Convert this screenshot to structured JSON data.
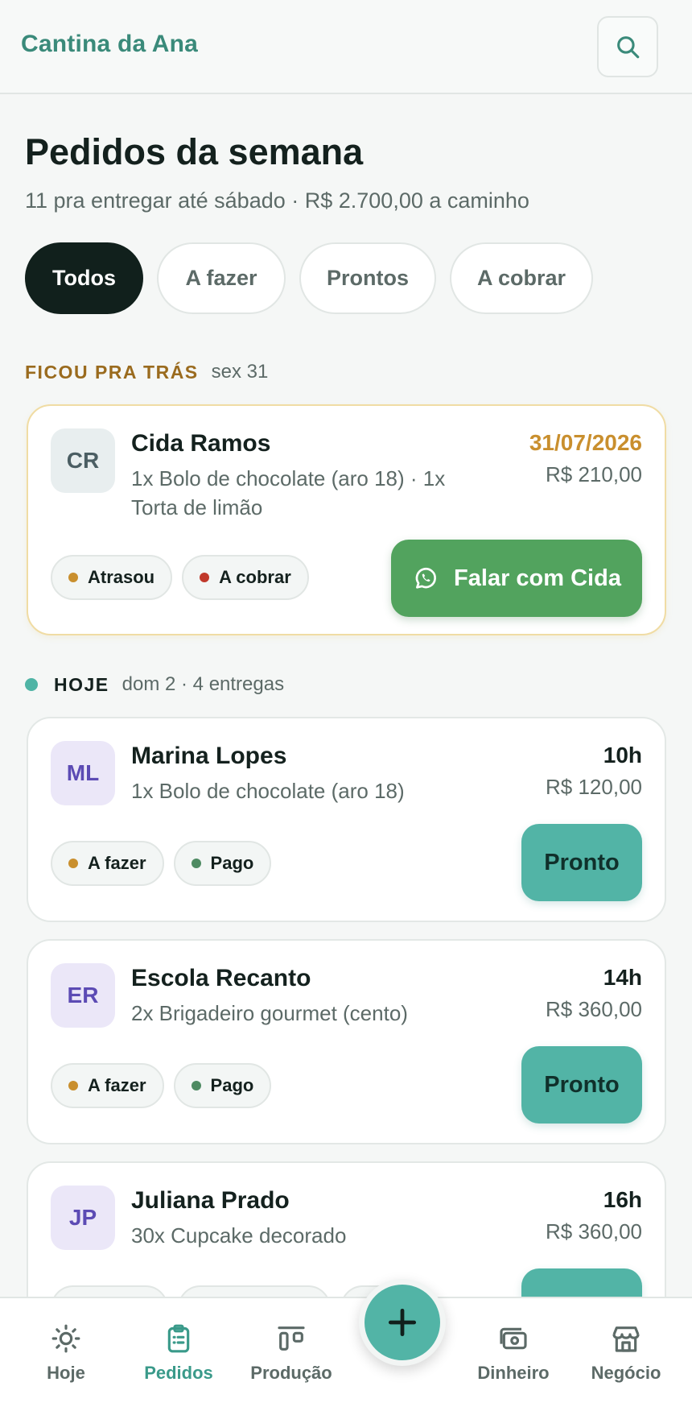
{
  "app": {
    "brand": "Cantina da Ana"
  },
  "header": {
    "title": "Pedidos da semana",
    "subtitle": "11 pra entregar até sábado · R$ 2.700,00 a caminho"
  },
  "filters": [
    "Todos",
    "A fazer",
    "Prontos",
    "A cobrar"
  ],
  "sections": {
    "late": {
      "label": "FICOU PRA TRÁS",
      "meta": "sex 31"
    },
    "today": {
      "label": "HOJE",
      "meta": "dom 2 · 4 entregas"
    }
  },
  "orders": [
    {
      "initials": "CR",
      "name": "Cida Ramos",
      "items": "1x Bolo de chocolate (aro 18) · 1x Torta de limão",
      "time": "31/07/2026",
      "price": "R$ 210,00",
      "tags": [
        "Atrasou",
        "A cobrar"
      ],
      "action": "Falar com Cida"
    },
    {
      "initials": "ML",
      "name": "Marina Lopes",
      "items": "1x Bolo de chocolate (aro 18)",
      "time": "10h",
      "price": "R$ 120,00",
      "tags": [
        "A fazer",
        "Pago"
      ],
      "action": "Pronto"
    },
    {
      "initials": "ER",
      "name": "Escola Recanto",
      "items": "2x Brigadeiro gourmet (cento)",
      "time": "14h",
      "price": "R$ 360,00",
      "tags": [
        "A fazer",
        "Pago"
      ],
      "action": "Pronto"
    },
    {
      "initials": "JP",
      "name": "Juliana Prado",
      "items": "30x Cupcake decorado",
      "time": "16h",
      "price": "R$ 360,00"
    }
  ],
  "nav": {
    "items": [
      "Hoje",
      "Pedidos",
      "Produção",
      "Dinheiro",
      "Negócio"
    ],
    "active": "Pedidos"
  },
  "colors": {
    "accent": "#52b4a6",
    "brand": "#3a8a7a",
    "whatsapp": "#52a35e",
    "warning": "#c98f2e",
    "danger": "#c0392b",
    "paid": "#4e8a62"
  },
  "icons": [
    "search-icon",
    "whatsapp-icon",
    "plus-icon",
    "sun-icon",
    "clipboard-icon",
    "production-icon",
    "money-icon",
    "store-icon"
  ]
}
